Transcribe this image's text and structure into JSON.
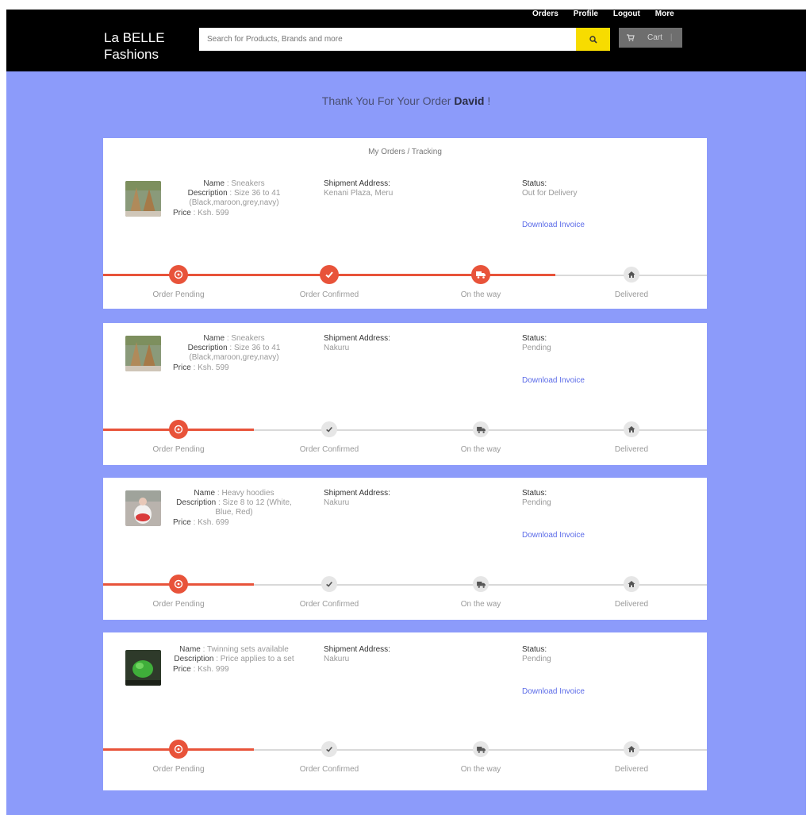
{
  "brand": {
    "line1": "La BELLE",
    "line2": "Fashions"
  },
  "nav": [
    "Orders",
    "Profile",
    "Logout",
    "More"
  ],
  "search": {
    "placeholder": "Search for Products, Brands and more"
  },
  "cart": {
    "label": "Cart"
  },
  "thanks": {
    "prefix": "Thank You For Your Order",
    "name": "David",
    "suffix": " !"
  },
  "section_title": "My Orders / Tracking",
  "labels": {
    "name": "Name",
    "description": "Description",
    "price": "Price",
    "shipment": "Shipment Address:",
    "status": "Status:",
    "invoice": "Download Invoice"
  },
  "steps": [
    "Order Pending",
    "Order Confirmed",
    "On the way",
    "Delivered"
  ],
  "colors": {
    "accent": "#e8533a",
    "page_bg": "#8c9bfa",
    "search_btn": "#f7dc00",
    "link": "#5b6be8"
  },
  "orders": [
    {
      "name": "Sneakers",
      "description": "Size 36 to 41 (Black,maroon,grey,navy)",
      "price": "Ksh. 599",
      "address": "Kenani Plaza, Meru",
      "status": "Out for Delivery",
      "progress_step": 3
    },
    {
      "name": "Sneakers",
      "description": "Size 36 to 41 (Black,maroon,grey,navy)",
      "price": "Ksh. 599",
      "address": "Nakuru",
      "status": "Pending",
      "progress_step": 1
    },
    {
      "name": "Heavy hoodies",
      "description": "Size 8 to 12 (White, Blue, Red)",
      "price": "Ksh. 699",
      "address": "Nakuru",
      "status": "Pending",
      "progress_step": 1
    },
    {
      "name": "Twinning sets available",
      "description": "Price applies to a set",
      "price": "Ksh. 999",
      "address": "Nakuru",
      "status": "Pending",
      "progress_step": 1
    }
  ]
}
